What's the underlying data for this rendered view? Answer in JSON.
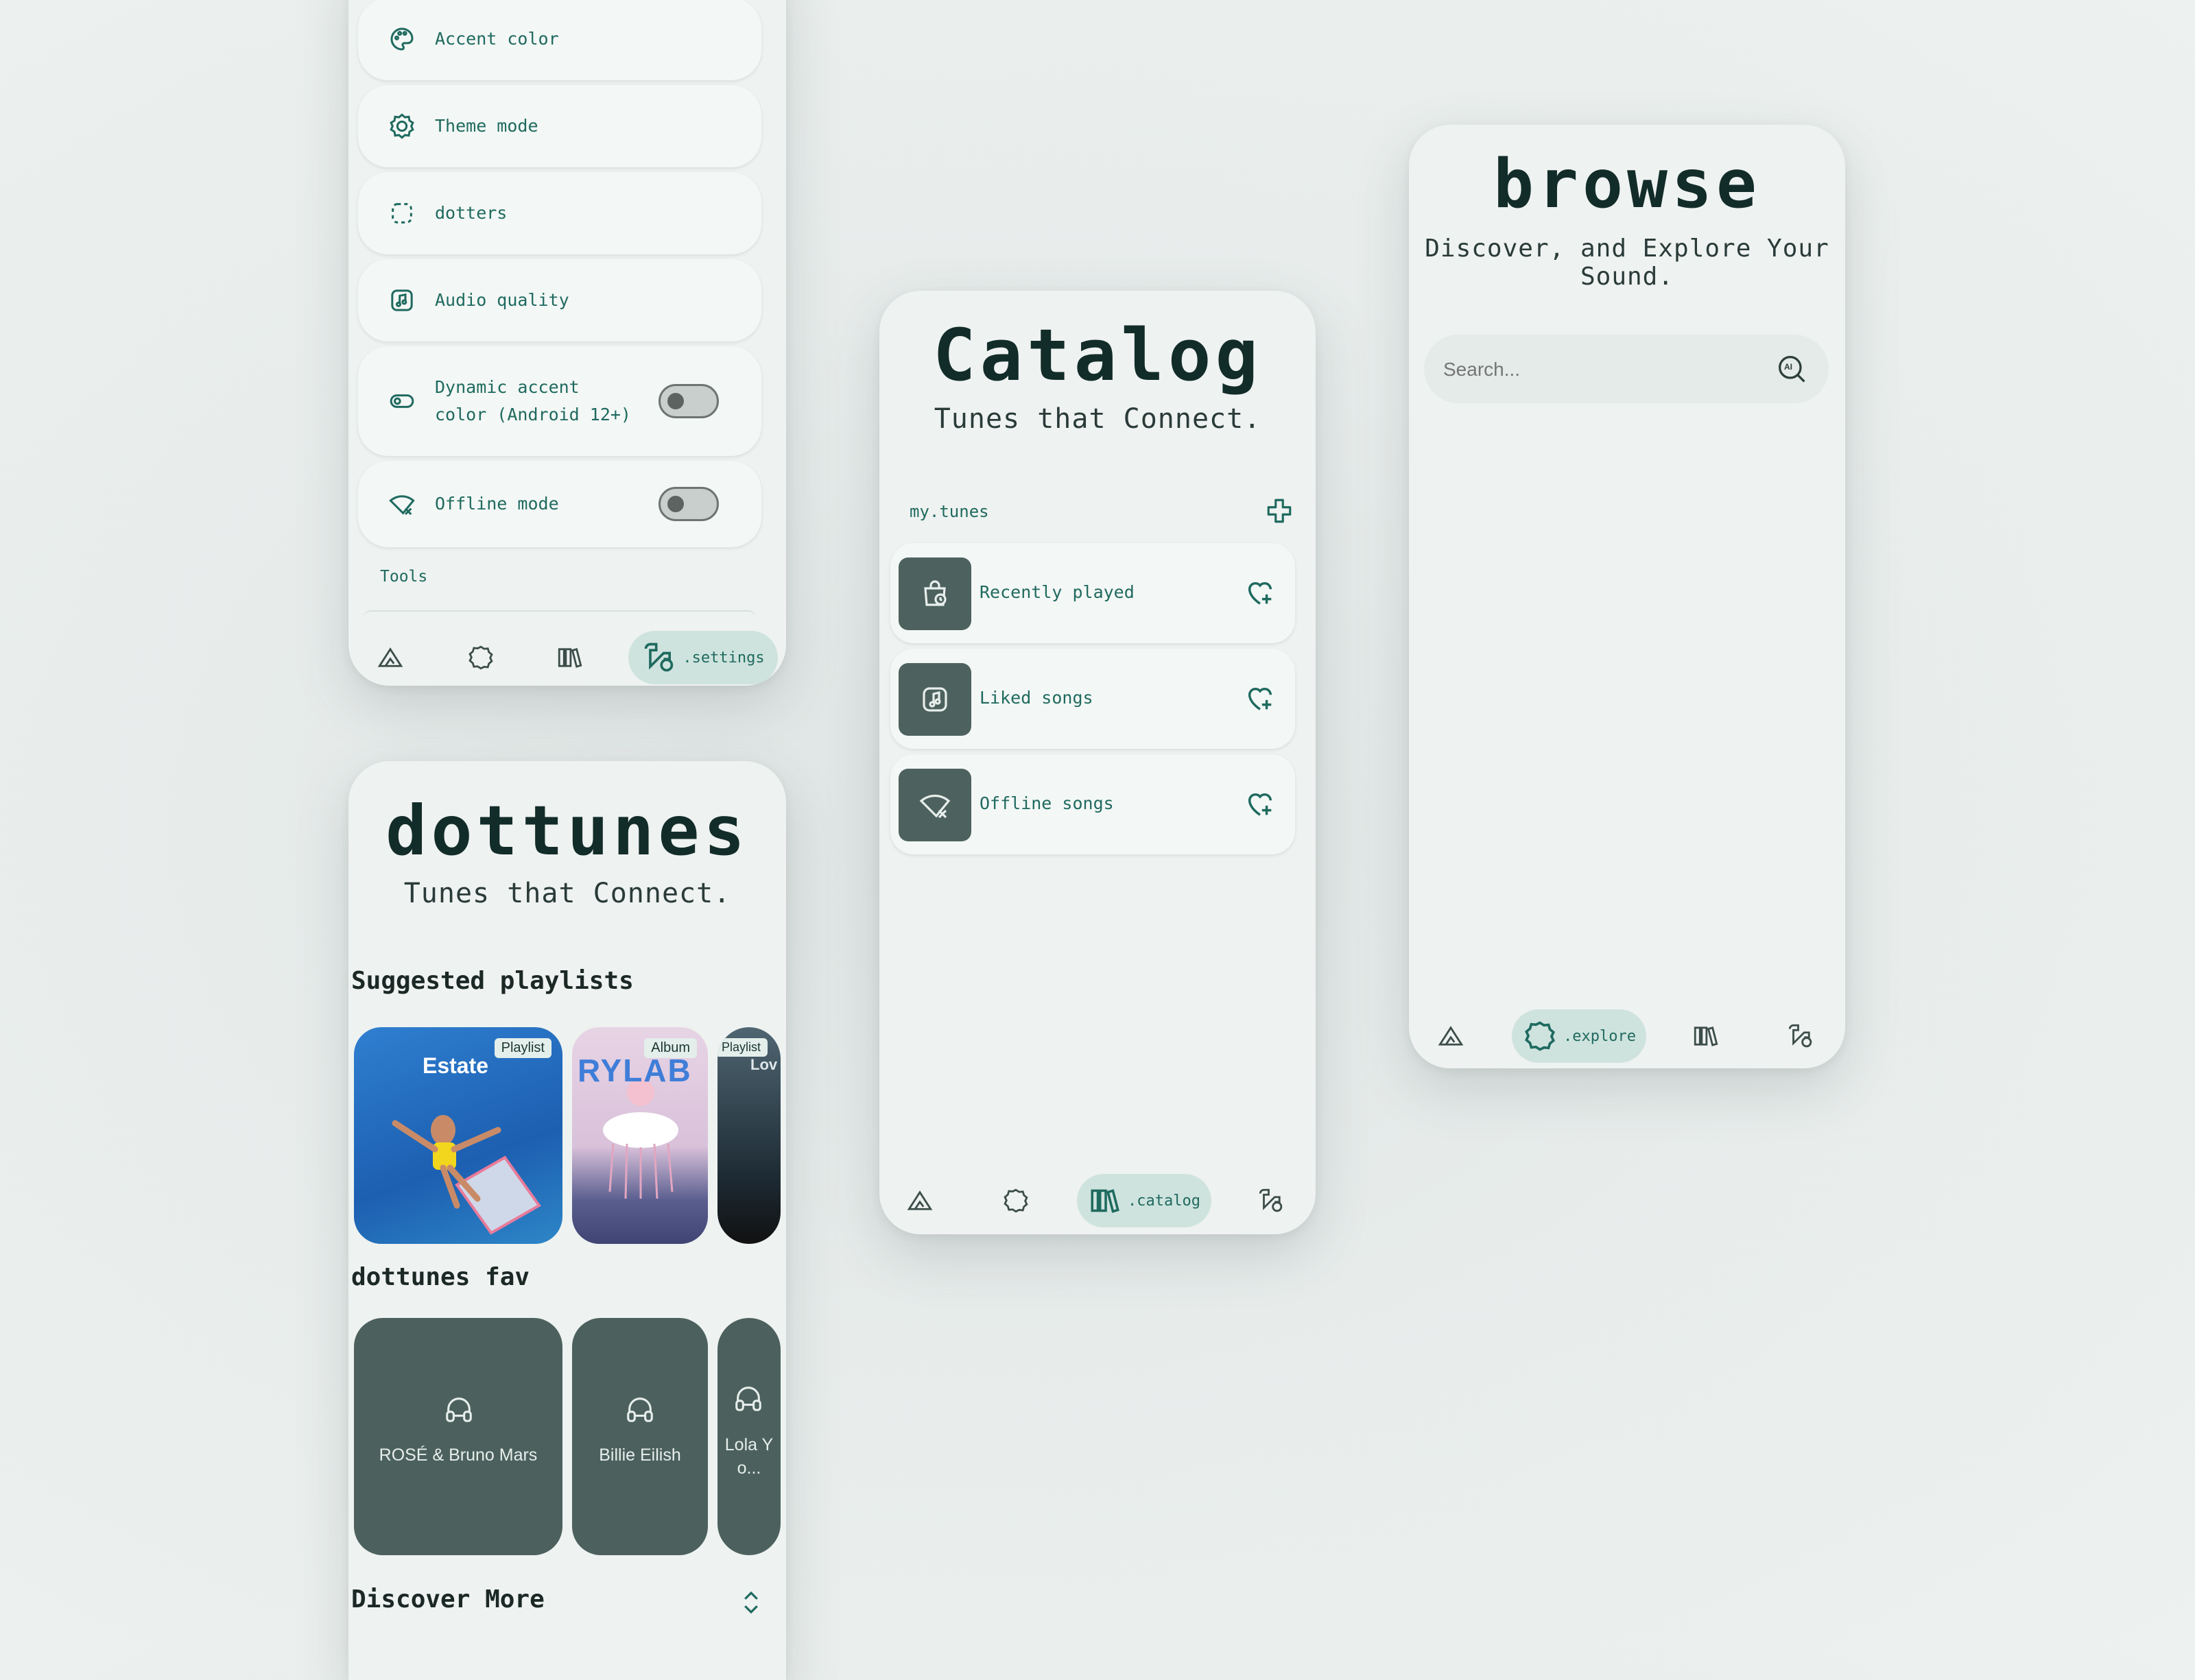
{
  "settings_screen": {
    "rows": [
      {
        "label": "Accent color",
        "icon": "palette-icon"
      },
      {
        "label": "Theme mode",
        "icon": "theme-mode-icon"
      },
      {
        "label": "dotters",
        "icon": "dotted-square-icon"
      },
      {
        "label": "Audio quality",
        "icon": "music-note-icon"
      },
      {
        "label": "Dynamic accent color (Android 12+)",
        "icon": "toggle-icon",
        "toggle": false
      },
      {
        "label": "Offline mode",
        "icon": "wifi-off-icon",
        "toggle": false
      }
    ],
    "section_tools": "Tools",
    "nav": {
      "active_label": ".settings"
    }
  },
  "home_screen": {
    "title": "dottunes",
    "tagline": "Tunes that Connect.",
    "suggested_heading": "Suggested playlists",
    "suggested": [
      {
        "badge": "Playlist",
        "cover_text": "Estate"
      },
      {
        "badge": "Album",
        "cover_text": "RYLAB"
      },
      {
        "badge": "Playlist",
        "cover_text": "Lov"
      }
    ],
    "fav_heading": "dottunes fav",
    "favs": [
      "ROSÉ & Bruno Mars",
      "Billie Eilish",
      "Lola Yo..."
    ],
    "discover_heading": "Discover More"
  },
  "catalog_screen": {
    "title": "Catalog",
    "tagline": "Tunes that Connect.",
    "section": "my.tunes",
    "items": [
      {
        "label": "Recently played",
        "icon": "history-bag-icon"
      },
      {
        "label": "Liked songs",
        "icon": "music-note-icon"
      },
      {
        "label": "Offline songs",
        "icon": "wifi-off-icon"
      }
    ],
    "nav": {
      "active_label": ".catalog"
    }
  },
  "browse_screen": {
    "title": "browse",
    "tagline": "Discover, and Explore Your Sound.",
    "search": {
      "placeholder": "Search...",
      "value": ""
    },
    "ai_icon_label": "AI",
    "nav": {
      "active_label": ".explore"
    }
  },
  "colors": {
    "accent": "#1f6a5f",
    "tile": "#4c615d",
    "pill": "#cfe3de"
  }
}
